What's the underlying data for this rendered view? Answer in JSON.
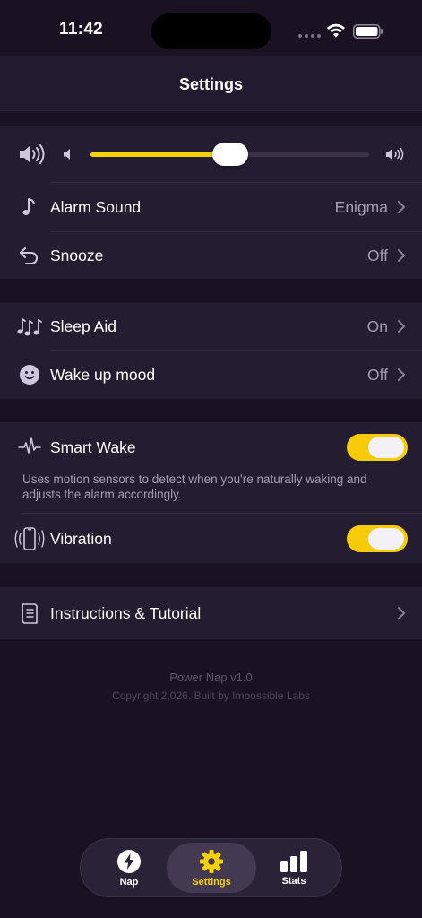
{
  "status_bar": {
    "time": "11:42"
  },
  "header": {
    "title": "Settings"
  },
  "sound": {
    "volume": 0.5,
    "alarm_sound": {
      "label": "Alarm Sound",
      "value": "Enigma"
    },
    "snooze": {
      "label": "Snooze",
      "value": "Off"
    }
  },
  "sleep": {
    "sleep_aid": {
      "label": "Sleep Aid",
      "value": "On"
    },
    "wake_mood": {
      "label": "Wake up mood",
      "value": "Off"
    }
  },
  "smart": {
    "smart_wake": {
      "label": "Smart Wake",
      "on": true,
      "description": "Uses motion sensors to detect when you're naturally waking and adjusts the alarm accordingly."
    },
    "vibration": {
      "label": "Vibration",
      "on": true
    }
  },
  "instructions": {
    "label": "Instructions & Tutorial"
  },
  "footer": {
    "version": "Power Nap v1.0",
    "copyright": "Copyright 2,026. Built by Impossible Labs"
  },
  "tabs": [
    {
      "label": "Nap",
      "icon": "bolt-icon",
      "active": false
    },
    {
      "label": "Settings",
      "icon": "gear-icon",
      "active": true
    },
    {
      "label": "Stats",
      "icon": "bar-chart-icon",
      "active": false
    }
  ],
  "colors": {
    "accent": "#f6d10a",
    "background": "#1a1223",
    "card": "#241c30",
    "muted": "#a59db4"
  }
}
